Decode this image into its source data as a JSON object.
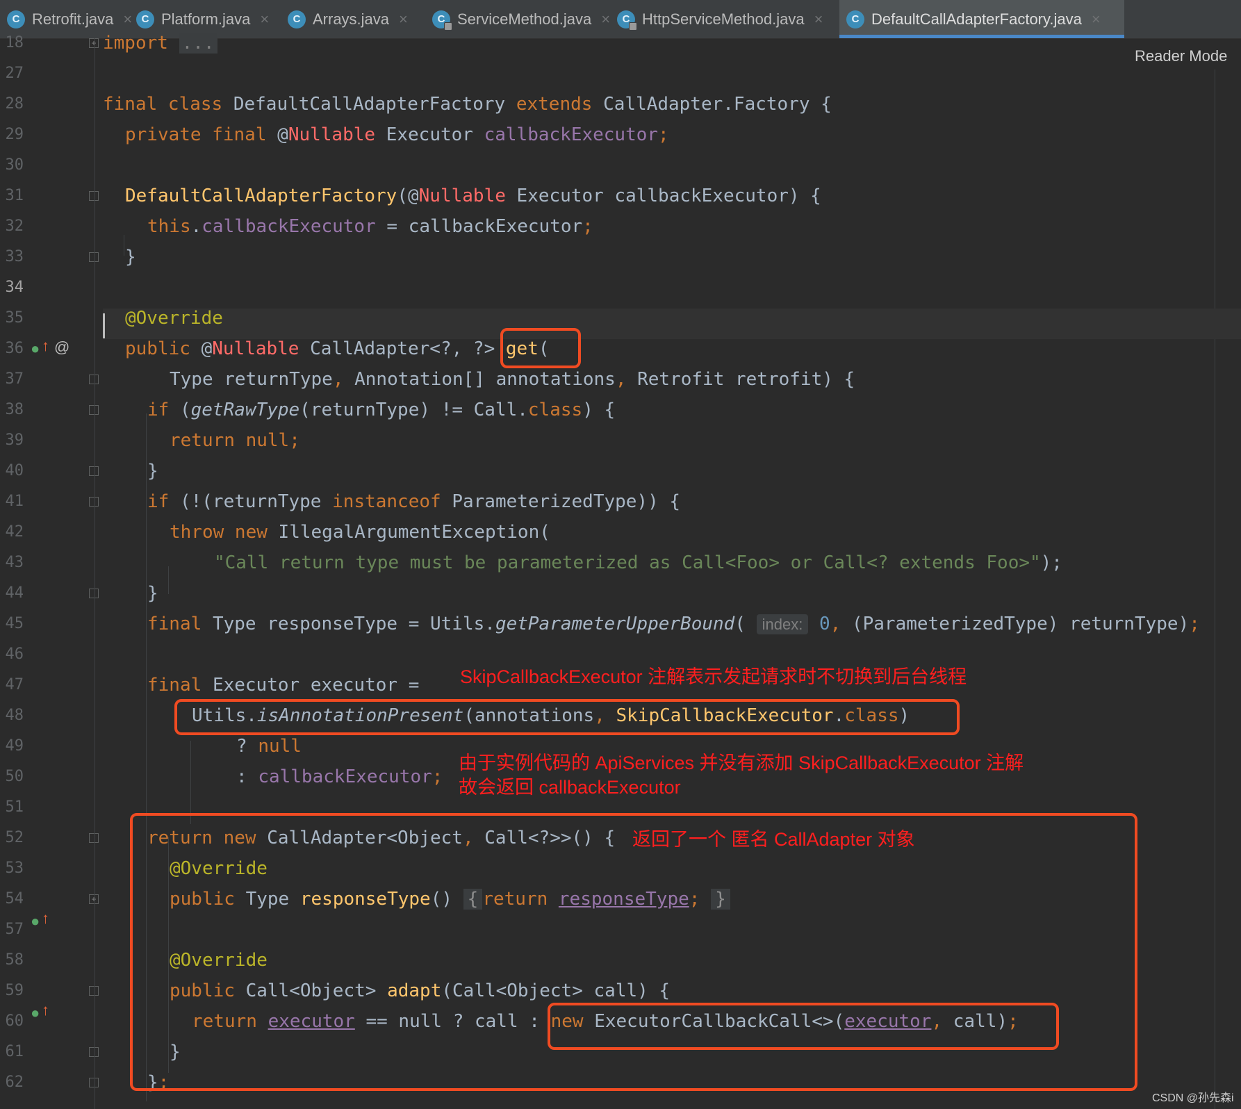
{
  "tabs": [
    {
      "label": "Retrofit.java",
      "icon": "class-icon",
      "locked": false,
      "active": false
    },
    {
      "label": "Platform.java",
      "icon": "class-icon",
      "locked": false,
      "active": false
    },
    {
      "label": "Arrays.java",
      "icon": "class-icon",
      "locked": false,
      "active": false
    },
    {
      "label": "ServiceMethod.java",
      "icon": "class-icon",
      "locked": true,
      "active": false
    },
    {
      "label": "HttpServiceMethod.java",
      "icon": "class-icon",
      "locked": true,
      "active": false
    },
    {
      "label": "DefaultCallAdapterFactory.java",
      "icon": "class-icon",
      "locked": false,
      "active": true
    }
  ],
  "tab_close_glyph": "×",
  "class_icon_letter": "C",
  "reader_mode": "Reader Mode",
  "current_line": "34",
  "line_numbers": [
    "18",
    "27",
    "28",
    "29",
    "30",
    "31",
    "32",
    "33",
    "34",
    "35",
    "36",
    "37",
    "38",
    "39",
    "40",
    "41",
    "42",
    "43",
    "44",
    "45",
    "46",
    "47",
    "48",
    "49",
    "50",
    "51",
    "52",
    "53",
    "54",
    "57",
    "58",
    "59",
    "60",
    "61",
    "62"
  ],
  "code": {
    "l18_import": "import",
    "l18_folded": "...",
    "l28_final_class": "final class",
    "l28_name": "DefaultCallAdapterFactory",
    "l28_extends": "extends",
    "l28_rest": "CallAdapter.Factory {",
    "l29_private_final": "private final",
    "l29_at": "@",
    "l29_nullable": "Nullable",
    "l29_type": "Executor",
    "l29_field": "callbackExecutor",
    "l29_semi": ";",
    "l31_ctor": "DefaultCallAdapterFactory",
    "l31_open": "(@",
    "l31_nullable": "Nullable",
    "l31_rest": "Executor callbackExecutor) {",
    "l32_this": "this",
    "l32_dot": ".",
    "l32_field": "callbackExecutor",
    "l32_rest": "= callbackExecutor",
    "l32_semi": ";",
    "l33": "}",
    "l35": "@Override",
    "l36_public": "public",
    "l36_at": "@",
    "l36_nullable": "Nullable",
    "l36_type": "CallAdapter<?, ?>",
    "l36_get": "get",
    "l36_paren": "(",
    "l37_a": "Type returnType",
    "l37_c1": ",",
    "l37_b": "Annotation[] annotations",
    "l37_c2": ",",
    "l37_c": "Retrofit retrofit) {",
    "l38_if": "if",
    "l38_open": "(",
    "l38_call": "getRawType",
    "l38_mid": "(returnType) != Call.",
    "l38_class": "class",
    "l38_close": ") {",
    "l39_return": "return",
    "l39_null": "null",
    "l39_semi": ";",
    "l40": "}",
    "l41_if": "if",
    "l41_open": "(!(returnType",
    "l41_instanceof": "instanceof",
    "l41_rest": "ParameterizedType)) {",
    "l42_throw_new": "throw new",
    "l42_rest": "IllegalArgumentException(",
    "l43_str": "\"Call return type must be parameterized as Call<Foo> or Call<? extends Foo>\"",
    "l43_close": ");",
    "l44": "}",
    "l45_final": "final",
    "l45_a": "Type responseType = Utils.",
    "l45_call": "getParameterUpperBound",
    "l45_open": "(",
    "l45_hint": "index:",
    "l45_zero": "0",
    "l45_comma": ",",
    "l45_rest": "(ParameterizedType) returnType)",
    "l45_semi": ";",
    "l47_final": "final",
    "l47_rest": "Executor executor =",
    "l48_utils": "Utils.",
    "l48_call": "isAnnotationPresent",
    "l48_args": "(annotations",
    "l48_comma": ",",
    "l48_ann": "SkipCallbackExecutor",
    "l48_dot": ".",
    "l48_class": "class",
    "l48_close": ")",
    "l49_q": "?",
    "l49_null": "null",
    "l50_colon": ":",
    "l50_field": "callbackExecutor",
    "l50_semi": ";",
    "l52_return_new": "return new",
    "l52_type": "CallAdapter<Object",
    "l52_comma": ",",
    "l52_rest": "Call<?>>() {",
    "l53": "@Override",
    "l54_public": "public",
    "l54_type": "Type",
    "l54_name": "responseType",
    "l54_parens": "()",
    "l54_lbrace": "{",
    "l54_return": "return",
    "l54_field": "responseType",
    "l54_semi": ";",
    "l54_rbrace": "}",
    "l58": "@Override",
    "l59_public": "public",
    "l59_type": "Call<Object>",
    "l59_name": "adapt",
    "l59_rest": "(Call<Object> call) {",
    "l60_return": "return",
    "l60_executor": "executor",
    "l60_mid": "== null ? call :",
    "l60_new": "new",
    "l60_type": "ExecutorCallbackCall<>(",
    "l60_executor2": "executor",
    "l60_comma": ",",
    "l60_rest": "call)",
    "l60_semi": ";",
    "l61": "}",
    "l62_brace": "}",
    "l62_semi": ";"
  },
  "annotations": {
    "note_skip": "SkipCallbackExecutor 注解表示发起请求时不切换到后台线程",
    "note_apiservices_1": "由于实例代码的 ApiServices 并没有添加 SkipCallbackExecutor 注解",
    "note_apiservices_2": "故会返回 callbackExecutor",
    "note_anonymous": "返回了一个 匿名 CallAdapter 对象",
    "box_color": "#f04b22",
    "text_color": "#ff1f1f"
  },
  "watermark": "CSDN @孙先森i",
  "colors": {
    "background": "#2b2b2b",
    "keyword": "#cc7832",
    "field": "#9876aa",
    "method": "#ffc66d",
    "annotation": "#bbb529",
    "nullable": "#ff6b68",
    "string": "#6a8759",
    "number": "#6897bb",
    "text": "#a9b7c6"
  }
}
